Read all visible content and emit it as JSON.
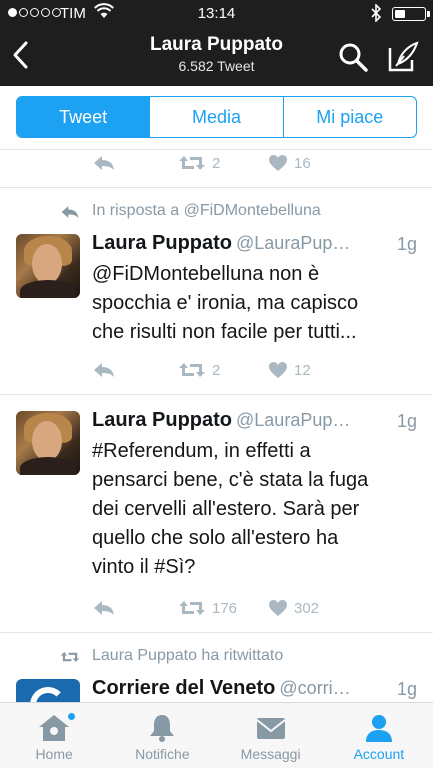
{
  "status_bar": {
    "carrier": "TIM",
    "time": "13:14"
  },
  "header": {
    "title": "Laura Puppato",
    "subtitle": "6.582 Tweet"
  },
  "tabs": [
    {
      "label": "Tweet",
      "active": true
    },
    {
      "label": "Media",
      "active": false
    },
    {
      "label": "Mi piace",
      "active": false
    }
  ],
  "tweets": [
    {
      "actions": {
        "retweets": "2",
        "likes": "16"
      }
    },
    {
      "context": "In risposta a @FiDMontebelluna",
      "context_icon": "reply-icon",
      "name": "Laura Puppato",
      "handle": "@LauraPup…",
      "time": "1g",
      "text_lines": [
        "@FiDMontebelluna non è",
        "spocchia e' ironia, ma capisco",
        "che risulti non facile per tutti..."
      ],
      "actions": {
        "retweets": "2",
        "likes": "12"
      }
    },
    {
      "name": "Laura Puppato",
      "handle": "@LauraPup…",
      "time": "1g",
      "text_lines": [
        "#Referendum, in effetti a",
        "pensarci bene, c'è stata la fuga",
        "dei cervelli all'estero. Sarà per",
        "quello che solo all'estero ha",
        "vinto il #Sì?"
      ],
      "actions": {
        "retweets": "176",
        "likes": "302"
      }
    },
    {
      "context": "Laura Puppato ha ritwittato",
      "context_icon": "retweet-icon",
      "name": "Corriere del Veneto",
      "handle": "@corri…",
      "time": "1g"
    }
  ],
  "tab_bar": [
    {
      "label": "Home",
      "icon": "home-icon",
      "active": false,
      "notification": true
    },
    {
      "label": "Notifiche",
      "icon": "bell-icon",
      "active": false
    },
    {
      "label": "Messaggi",
      "icon": "envelope-icon",
      "active": false
    },
    {
      "label": "Account",
      "icon": "person-icon",
      "active": true
    }
  ],
  "colors": {
    "accent": "#1da1f2",
    "header_bg": "#1e1e1e",
    "muted": "#8899a6"
  }
}
